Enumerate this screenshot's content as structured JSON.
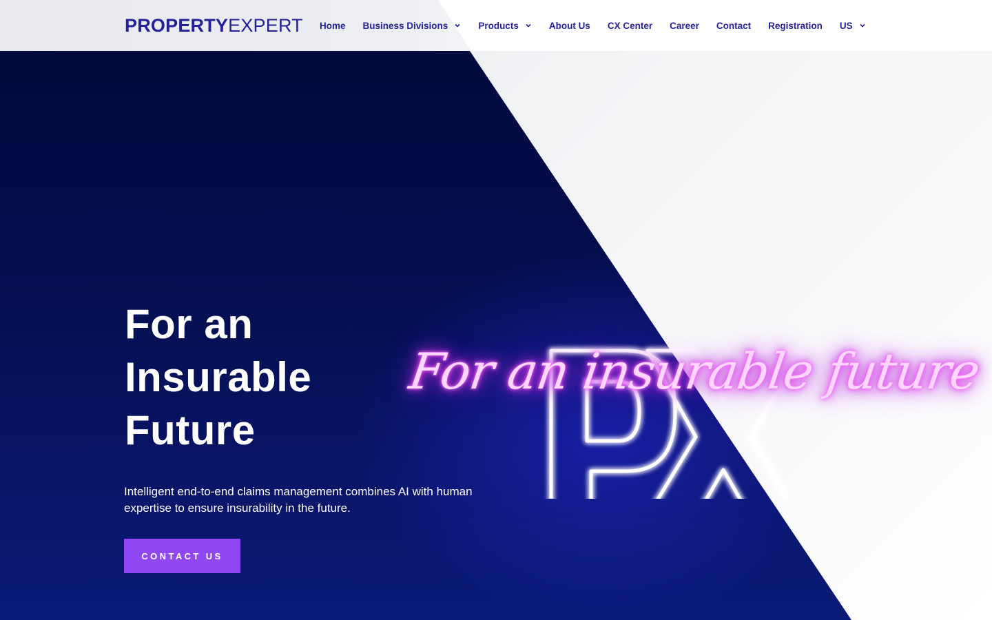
{
  "header": {
    "logo": {
      "bold": "PROPERTY",
      "light": "EXPERT"
    },
    "nav": [
      {
        "label": "Home",
        "dropdown": false
      },
      {
        "label": "Business Divisions",
        "dropdown": true
      },
      {
        "label": "Products",
        "dropdown": true
      },
      {
        "label": "About Us",
        "dropdown": false
      },
      {
        "label": "CX Center",
        "dropdown": false
      },
      {
        "label": "Career",
        "dropdown": false
      },
      {
        "label": "Contact",
        "dropdown": false
      },
      {
        "label": "Registration",
        "dropdown": false
      },
      {
        "label": "US",
        "dropdown": true
      }
    ]
  },
  "hero": {
    "title_lines": [
      "For an",
      "Insurable",
      "Future"
    ],
    "description": "Intelligent end-to-end claims management combines AI with human expertise to ensure insurability in the future.",
    "cta_label": "CONTACT US",
    "neon_script": "For an insurable future",
    "neon_letters": "PX"
  },
  "colors": {
    "brand": "#24219a",
    "hero_dark": "#050f52",
    "cta": "#9049f2",
    "neon_pink": "#e23ff0"
  }
}
